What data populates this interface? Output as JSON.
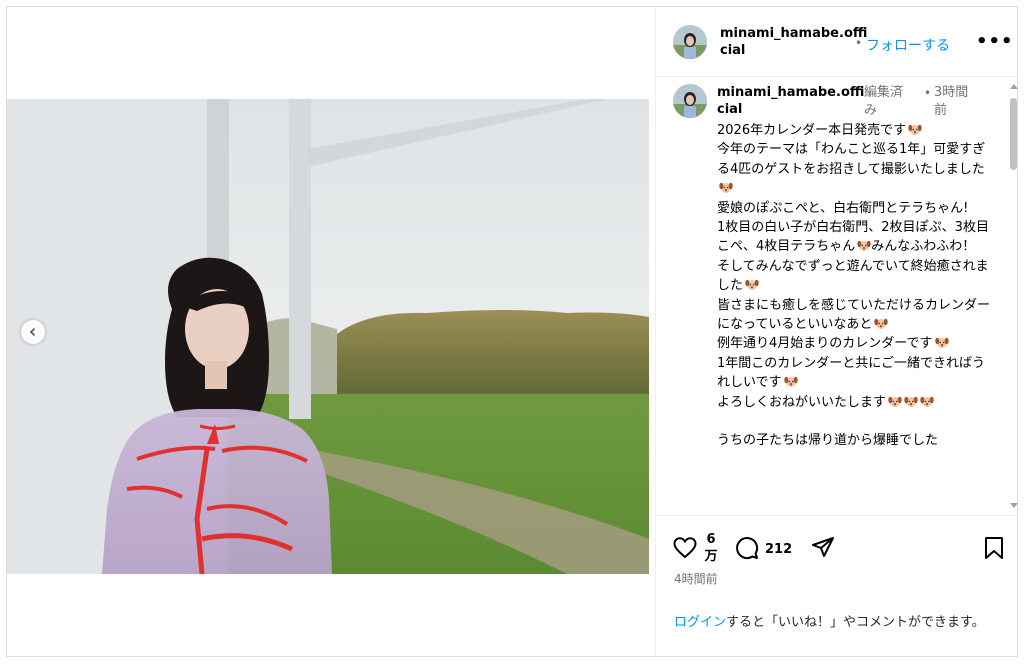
{
  "post": {
    "username": "minami_hamabe.official",
    "username_line1": "minami_hamabe.offi",
    "username_line2": "cial",
    "follow_label": "フォローする",
    "separator": "•",
    "more_label": "•••"
  },
  "caption": {
    "username_line1": "minami_hamabe.offi",
    "username_line2": "cial",
    "edited_label": "編集済み",
    "time_label": "3時間前",
    "lines": [
      "2026年カレンダー本日発売です",
      "今年のテーマは「わんこと巡る1年」可愛すぎる4匹のゲストをお招きして撮影いたしました",
      "愛娘のぽぷこぺと、白右衛門とテラちゃん!",
      "1枚目の白い子が白右衛門、2枚目ぽぷ、3枚目こぺ、4枚目テラちゃん",
      "みんなふわふわ！",
      "そしてみんなでずっと遊んでいて終始癒されました",
      "皆さまにも癒しを感じていただけるカレンダーになっているといいなあと",
      "例年通り4月始まりのカレンダーです",
      "1年間このカレンダーと共にご一緒できればうれしいです",
      "よろしくおねがいいたします",
      "うちの子たちは帰り道から爆睡でした"
    ]
  },
  "actions": {
    "likes_line1": "6",
    "likes_line2": "万",
    "comments_count": "212",
    "timestamp": "4時間前"
  },
  "login_prompt": {
    "link": "ログイン",
    "rest": "すると「いいね！」やコメントができます。"
  },
  "colors": {
    "accent": "#0095f6",
    "secondary_text": "#737373",
    "border": "#dbdbdb"
  },
  "icons": [
    "chevron-left-icon",
    "heart-icon",
    "comment-icon",
    "share-icon",
    "bookmark-icon",
    "dog-emoji-icon",
    "more-icon"
  ]
}
